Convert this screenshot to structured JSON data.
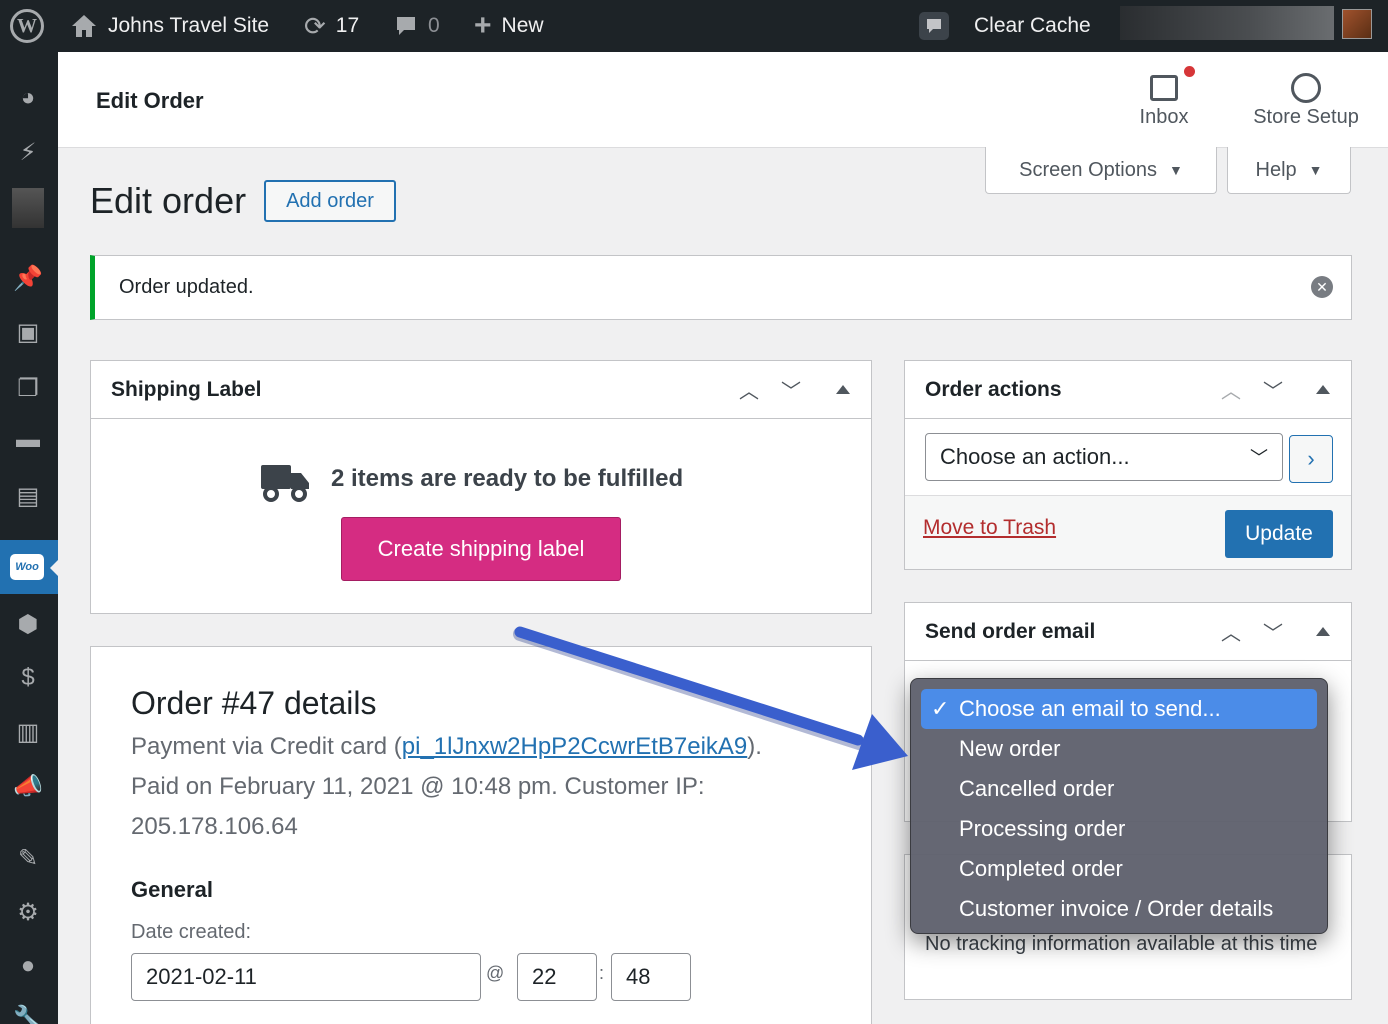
{
  "adminbar": {
    "site_name": "Johns Travel Site",
    "updates_count": "17",
    "comments_count": "0",
    "new_label": "New",
    "clear_cache": "Clear Cache"
  },
  "header": {
    "title": "Edit Order",
    "inbox_label": "Inbox",
    "store_setup_label": "Store Setup"
  },
  "screen_options": {
    "label": "Screen Options",
    "help": "Help"
  },
  "page": {
    "title": "Edit order",
    "add_order": "Add order"
  },
  "notice": {
    "text": "Order updated."
  },
  "shipping": {
    "title": "Shipping Label",
    "message": "2 items are ready to be fulfilled",
    "button": "Create shipping label"
  },
  "details": {
    "title": "Order #47 details",
    "payment_prefix": "Payment via Credit card (",
    "payment_id": "pi_1lJnxw2HpP2CcwrEtB7eikA9",
    "payment_suffix": ").",
    "paid_line": "Paid on February 11, 2021 @ 10:48 pm. Customer IP:",
    "ip": "205.178.106.64",
    "general": "General",
    "date_label": "Date created:",
    "date": "2021-02-11",
    "hour": "22",
    "minute": "48"
  },
  "order_actions": {
    "title": "Order actions",
    "select": "Choose an action...",
    "trash": "Move to Trash",
    "update": "Update"
  },
  "email_box": {
    "title": "Send order email"
  },
  "tracking": {
    "text": "No tracking information available at this time"
  },
  "dropdown": {
    "options": [
      "Choose an email to send...",
      "New order",
      "Cancelled order",
      "Processing order",
      "Completed order",
      "Customer invoice / Order details"
    ],
    "selected_index": 0
  },
  "colors": {
    "admin_bar": "#1d2327",
    "accent": "#2271b1",
    "shipping_button": "#d52c82",
    "notice_success": "#00a32a",
    "annotation_arrow": "#3a5fcd"
  }
}
